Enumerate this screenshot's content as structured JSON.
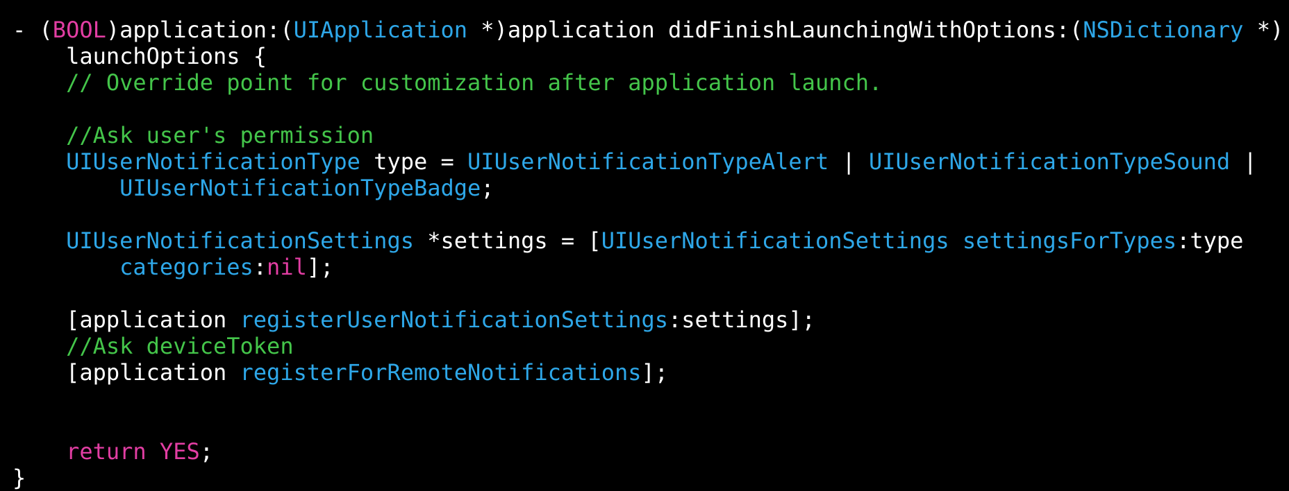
{
  "theme": {
    "background": "#000000",
    "plain": "#ffffff",
    "keyword": "#e23ea3",
    "type": "#2ea7e8",
    "method": "#2ea7e8",
    "comment": "#44c54a"
  },
  "code": {
    "lines": [
      [
        {
          "t": "- (",
          "k": "plain"
        },
        {
          "t": "BOOL",
          "k": "keyword"
        },
        {
          "t": ")application:(",
          "k": "plain"
        },
        {
          "t": "UIApplication",
          "k": "type"
        },
        {
          "t": " *)application didFinishLaunchingWithOptions:(",
          "k": "plain"
        },
        {
          "t": "NSDictionary",
          "k": "type"
        },
        {
          "t": " *)",
          "k": "plain"
        }
      ],
      [
        {
          "t": "    launchOptions {",
          "k": "plain"
        }
      ],
      [
        {
          "t": "    ",
          "k": "plain"
        },
        {
          "t": "// Override point for customization after application launch.",
          "k": "comment"
        }
      ],
      [],
      [
        {
          "t": "    ",
          "k": "plain"
        },
        {
          "t": "//Ask user's permission",
          "k": "comment"
        }
      ],
      [
        {
          "t": "    ",
          "k": "plain"
        },
        {
          "t": "UIUserNotificationType",
          "k": "type"
        },
        {
          "t": " type = ",
          "k": "plain"
        },
        {
          "t": "UIUserNotificationTypeAlert",
          "k": "type"
        },
        {
          "t": " | ",
          "k": "plain"
        },
        {
          "t": "UIUserNotificationTypeSound",
          "k": "type"
        },
        {
          "t": " |",
          "k": "plain"
        }
      ],
      [
        {
          "t": "        ",
          "k": "plain"
        },
        {
          "t": "UIUserNotificationTypeBadge",
          "k": "type"
        },
        {
          "t": ";",
          "k": "plain"
        }
      ],
      [],
      [
        {
          "t": "    ",
          "k": "plain"
        },
        {
          "t": "UIUserNotificationSettings",
          "k": "type"
        },
        {
          "t": " *settings = [",
          "k": "plain"
        },
        {
          "t": "UIUserNotificationSettings",
          "k": "type"
        },
        {
          "t": " ",
          "k": "plain"
        },
        {
          "t": "settingsForTypes",
          "k": "method"
        },
        {
          "t": ":type",
          "k": "plain"
        }
      ],
      [
        {
          "t": "        ",
          "k": "plain"
        },
        {
          "t": "categories",
          "k": "method"
        },
        {
          "t": ":",
          "k": "plain"
        },
        {
          "t": "nil",
          "k": "keyword"
        },
        {
          "t": "];",
          "k": "plain"
        }
      ],
      [],
      [
        {
          "t": "    [application ",
          "k": "plain"
        },
        {
          "t": "registerUserNotificationSettings",
          "k": "method"
        },
        {
          "t": ":settings];",
          "k": "plain"
        }
      ],
      [
        {
          "t": "    ",
          "k": "plain"
        },
        {
          "t": "//Ask deviceToken",
          "k": "comment"
        }
      ],
      [
        {
          "t": "    [application ",
          "k": "plain"
        },
        {
          "t": "registerForRemoteNotifications",
          "k": "method"
        },
        {
          "t": "];",
          "k": "plain"
        }
      ],
      [],
      [],
      [
        {
          "t": "    ",
          "k": "plain"
        },
        {
          "t": "return",
          "k": "keyword"
        },
        {
          "t": " ",
          "k": "plain"
        },
        {
          "t": "YES",
          "k": "keyword"
        },
        {
          "t": ";",
          "k": "plain"
        }
      ],
      [
        {
          "t": "}",
          "k": "plain"
        }
      ]
    ]
  }
}
